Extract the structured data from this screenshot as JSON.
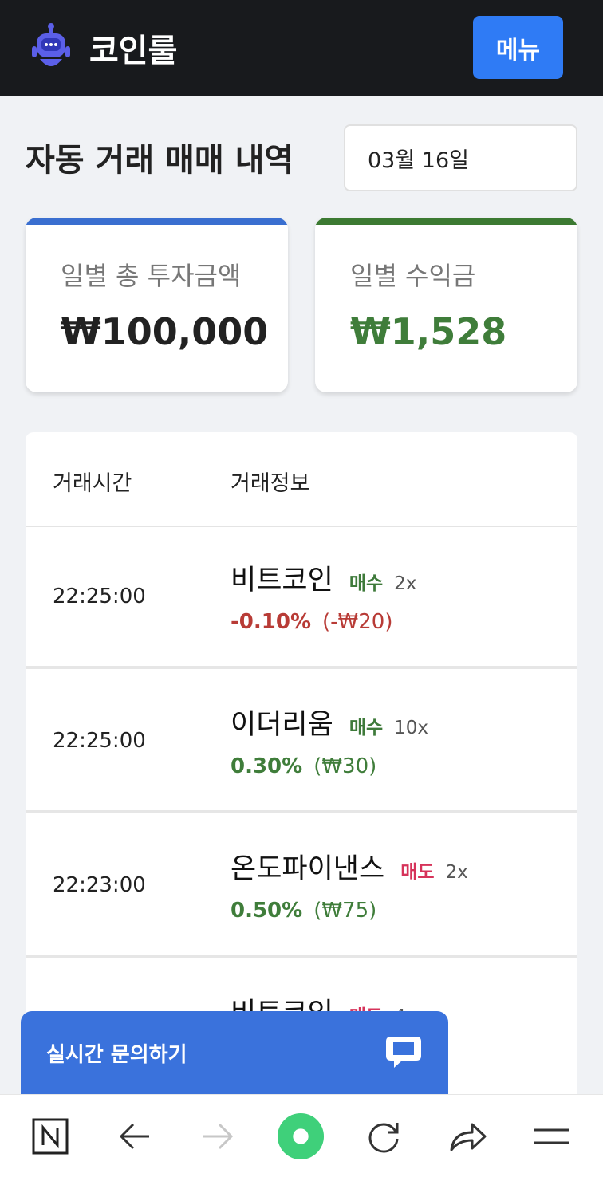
{
  "header": {
    "brand": "코인룰",
    "menu_label": "메뉴"
  },
  "page": {
    "title": "자동 거래 매매 내역",
    "date": "03월 16일"
  },
  "summary": {
    "investment_label": "일별 총 투자금액",
    "investment_value": "₩100,000",
    "profit_label": "일별 수익금",
    "profit_value": "₩1,528"
  },
  "table": {
    "headers": {
      "time": "거래시간",
      "info": "거래정보"
    },
    "rows": [
      {
        "time": "22:25:00",
        "coin": "비트코인",
        "side": "매수",
        "leverage": "2x",
        "pct": "-0.10%",
        "amount": "(-₩20)"
      },
      {
        "time": "22:25:00",
        "coin": "이더리움",
        "side": "매수",
        "leverage": "10x",
        "pct": "0.30%",
        "amount": "(₩30)"
      },
      {
        "time": "22:23:00",
        "coin": "온도파이낸스",
        "side": "매도",
        "leverage": "2x",
        "pct": "0.50%",
        "amount": "(₩75)"
      },
      {
        "time": "",
        "coin": "비트코인",
        "side": "매도",
        "leverage": "4x",
        "pct": "",
        "amount": ""
      }
    ]
  },
  "chat": {
    "label": "실시간 문의하기"
  },
  "colors": {
    "buy": "#3e7a3a",
    "sell": "#d6335a",
    "loss": "#b83b36",
    "gain": "#3f7d3a",
    "card1_bar": "#3a6fd0",
    "card2_bar": "#3c7a32"
  },
  "navbar": {
    "icons": [
      "naver-logo-icon",
      "back-arrow-icon",
      "forward-arrow-icon",
      "green-dot-icon",
      "refresh-icon",
      "share-icon",
      "menu-lines-icon"
    ]
  }
}
